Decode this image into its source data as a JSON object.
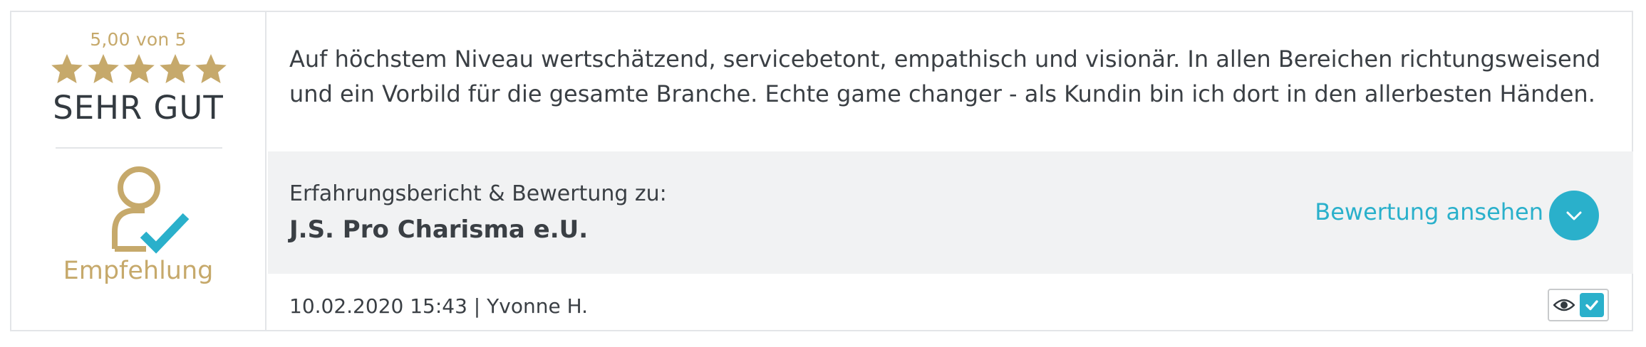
{
  "rating": {
    "score_text": "5,00 von 5",
    "stars": 5,
    "max_stars": 5,
    "label": "SEHR GUT",
    "recommendation_label": "Empfehlung"
  },
  "review": {
    "text": "Auf höchstem Niveau wertschätzend, servicebetont, empathisch und visionär. In allen Bereichen richtungsweisend und ein Vorbild für die gesamte Branche. Echte game changer - als Kundin bin ich dort in den allerbesten Händen."
  },
  "info": {
    "subtitle": "Erfahrungsbericht & Bewertung zu:",
    "company": "J.S. Pro Charisma e.U.",
    "view_link_label": "Bewertung ansehen"
  },
  "meta": {
    "date_author": "10.02.2020 15:43 | Yvonne H."
  },
  "icons": {
    "stars": "star-icon",
    "recommend": "user-check-icon",
    "expand": "chevron-down-icon",
    "visible": "eye-icon",
    "verified": "checkbox-check-icon"
  },
  "colors": {
    "gold": "#c6a96b",
    "accent": "#2ab0cb",
    "text": "#3a3f44",
    "band": "#f1f2f3",
    "border": "#e3e5e8"
  }
}
